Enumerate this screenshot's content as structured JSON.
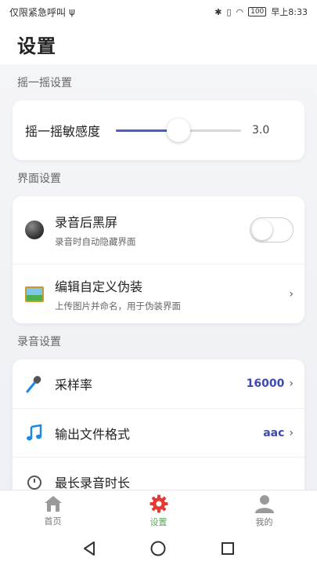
{
  "status_bar": {
    "left_text": "仅限紧急呼叫",
    "battery": "100",
    "time": "早上8:33"
  },
  "header": {
    "title": "设置"
  },
  "sections": {
    "shake": {
      "title": "摇一摇设置",
      "sensitivity_label": "摇一摇敏感度",
      "sensitivity_value": "3.0",
      "slider_fraction": 0.5
    },
    "ui": {
      "title": "界面设置",
      "black_screen": {
        "title": "录音后黑屏",
        "subtitle": "录音时自动隐藏界面",
        "enabled": false
      },
      "disguise": {
        "title": "编辑自定义伪装",
        "subtitle": "上传图片并命名，用于伪装界面",
        "chevron": "›"
      }
    },
    "record": {
      "title": "录音设置",
      "sample_rate": {
        "label": "采样率",
        "value": "16000",
        "chevron": "›"
      },
      "format": {
        "label": "输出文件格式",
        "value": "aac",
        "chevron": "›"
      },
      "max_duration": {
        "label": "最长录音时长"
      }
    }
  },
  "tabbar": {
    "tabs": [
      {
        "label": "首页",
        "icon": "home-icon",
        "active": false
      },
      {
        "label": "设置",
        "icon": "gear-icon",
        "active": true
      },
      {
        "label": "我的",
        "icon": "person-icon",
        "active": false
      }
    ],
    "active_color": "#4caf50"
  },
  "colors": {
    "accent": "#4b5bd4",
    "value_blue": "#3c4ab0"
  }
}
